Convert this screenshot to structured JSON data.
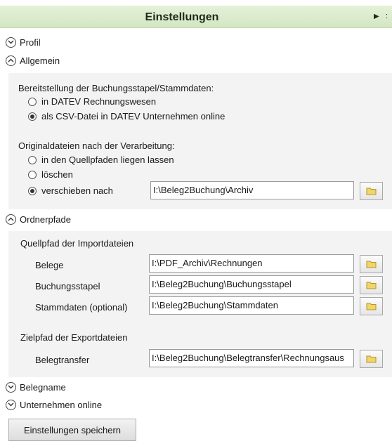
{
  "header": {
    "title": "Einstellungen",
    "extra": ":"
  },
  "sections": {
    "profil": "Profil",
    "allgemein": "Allgemein",
    "ordnerpfade": "Ordnerpfade",
    "belegname": "Belegname",
    "unternehmen_online": "Unternehmen online"
  },
  "allgemein": {
    "bereitstellung_label": "Bereitstellung der Buchungsstapel/Stammdaten:",
    "bereitstellung_options": [
      {
        "label": "in DATEV Rechnungswesen",
        "selected": false
      },
      {
        "label": "als CSV-Datei in DATEV Unternehmen online",
        "selected": true
      }
    ],
    "original_label": "Originaldateien nach der Verarbeitung:",
    "original_options": [
      {
        "label": "in den Quellpfaden liegen lassen",
        "selected": false
      },
      {
        "label": "löschen",
        "selected": false
      },
      {
        "label": "verschieben nach",
        "selected": true
      }
    ],
    "verschieben_path": "I:\\Beleg2Buchung\\Archiv"
  },
  "ordnerpfade": {
    "quell_label": "Quellpfad der Importdateien",
    "belege_label": "Belege",
    "belege_path": "I:\\PDF_Archiv\\Rechnungen",
    "buchungsstapel_label": "Buchungsstapel",
    "buchungsstapel_path": "I:\\Beleg2Buchung\\Buchungsstapel",
    "stammdaten_label": "Stammdaten (optional)",
    "stammdaten_path": "I:\\Beleg2Buchung\\Stammdaten",
    "ziel_label": "Zielpfad der Exportdateien",
    "belegtransfer_label": "Belegtransfer",
    "belegtransfer_path": "I:\\Beleg2Buchung\\Belegtransfer\\Rechnungsaus"
  },
  "save_button_label": "Einstellungen speichern",
  "icons": {
    "expand": "chevron-down-icon",
    "collapse": "chevron-up-icon",
    "browse": "folder-icon",
    "header_arrow": "triangle-right-icon"
  },
  "colors": {
    "header_bg": "#dbeccd",
    "panel_bg": "#f3f3f3",
    "folder": "#e8c84a"
  }
}
